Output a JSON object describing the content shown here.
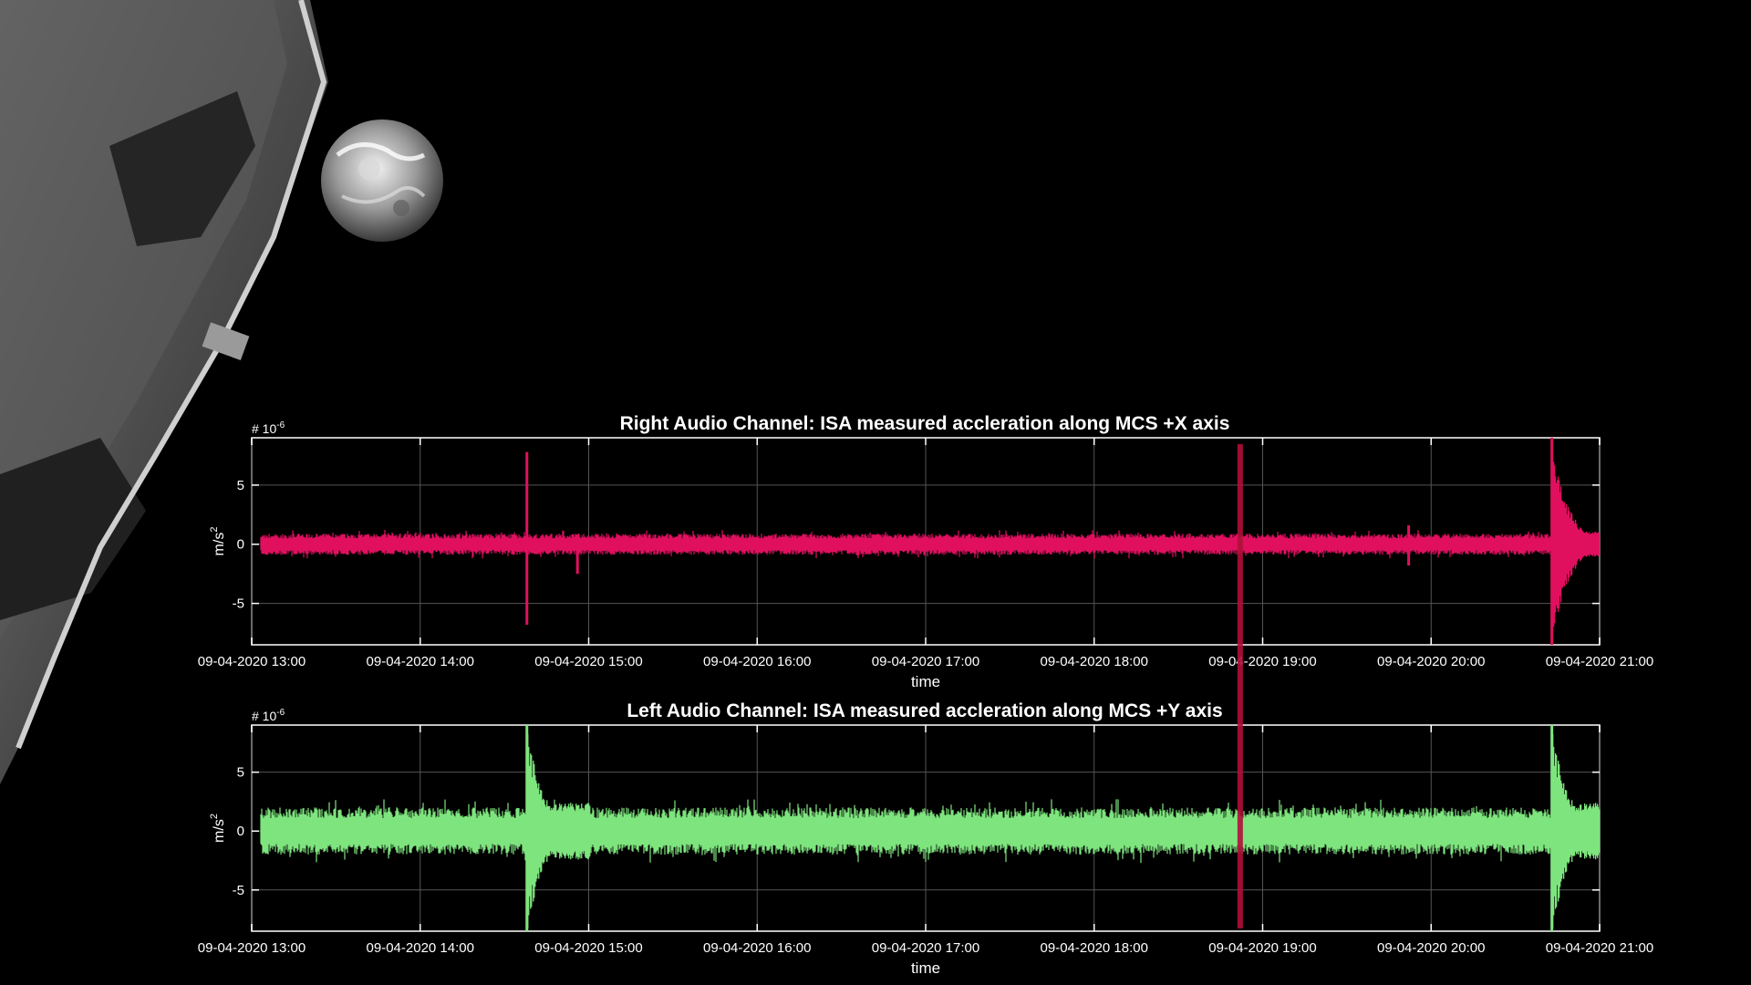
{
  "colors": {
    "background": "#000000",
    "right_channel": "#e0105f",
    "left_channel": "#7ee57e",
    "cursor": "#b0103a",
    "axes": "#ffffff",
    "grid": "#555555"
  },
  "scene": {
    "spacecraft_panel": "spacecraft-solar-panel",
    "earth": "earth"
  },
  "chart_data": [
    {
      "type": "line",
      "title": "Right Audio Channel: ISA measured accleration along MCS +X axis",
      "xlabel": "time",
      "ylabel": "m/s2",
      "ylabel_base": "m/s",
      "ylabel_sup": "2",
      "multiplier_base": "# 10",
      "multiplier_sup": "-6",
      "xlim": [
        "09-04-2020 13:00",
        "09-04-2020 21:00"
      ],
      "ylim": [
        -8.5,
        9
      ],
      "xticks": [
        "09-04-2020 13:00",
        "09-04-2020 14:00",
        "09-04-2020 15:00",
        "09-04-2020 16:00",
        "09-04-2020 17:00",
        "09-04-2020 18:00",
        "09-04-2020 19:00",
        "09-04-2020 20:00",
        "09-04-2020 21:00"
      ],
      "yticks": [
        -5,
        0,
        5
      ],
      "grid": true,
      "series": [
        {
          "noise_band": [
            -0.9,
            0.9
          ],
          "spikes": [
            {
              "time": "09-04-2020 14:38",
              "min": -6.8,
              "max": 7.8
            },
            {
              "time": "09-04-2020 14:56",
              "min": -2.5,
              "max": 0.8
            },
            {
              "time": "09-04-2020 19:52",
              "min": -1.8,
              "max": 1.6
            },
            {
              "time": "09-04-2020 20:43",
              "min": -8.5,
              "max": 9.0
            }
          ]
        }
      ]
    },
    {
      "type": "line",
      "title": "Left Audio Channel: ISA measured accleration along MCS +Y axis",
      "xlabel": "time",
      "ylabel": "m/s2",
      "ylabel_base": "m/s",
      "ylabel_sup": "2",
      "multiplier_base": "# 10",
      "multiplier_sup": "-6",
      "xlim": [
        "09-04-2020 13:00",
        "09-04-2020 21:00"
      ],
      "ylim": [
        -8.5,
        9
      ],
      "xticks": [
        "09-04-2020 13:00",
        "09-04-2020 14:00",
        "09-04-2020 15:00",
        "09-04-2020 16:00",
        "09-04-2020 17:00",
        "09-04-2020 18:00",
        "09-04-2020 19:00",
        "09-04-2020 20:00",
        "09-04-2020 21:00"
      ],
      "yticks": [
        -5,
        0,
        5
      ],
      "grid": true,
      "series": [
        {
          "noise_band": [
            -2.0,
            2.0
          ],
          "spikes": [
            {
              "time": "09-04-2020 14:38",
              "min": -8.5,
              "max": 9.0
            },
            {
              "time": "09-04-2020 20:43",
              "min": -8.5,
              "max": 9.0
            }
          ]
        }
      ]
    }
  ],
  "cursor": {
    "time": "09-04-2020 18:52"
  }
}
